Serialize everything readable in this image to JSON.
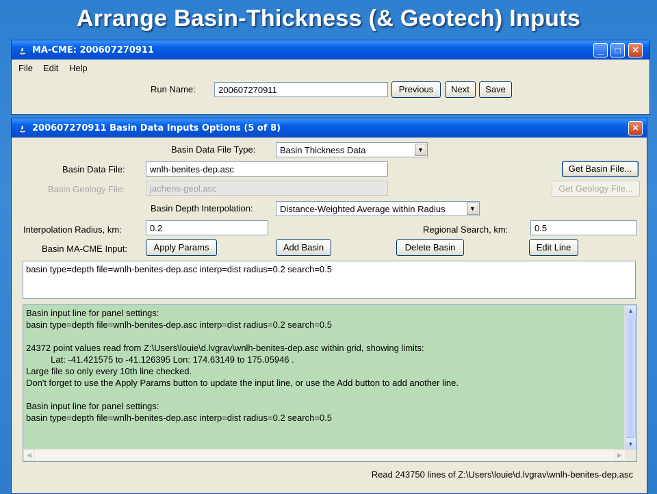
{
  "slide": {
    "title": "Arrange Basin-Thickness (& Geotech) Inputs"
  },
  "main_window": {
    "title": "MA-CME: 200607270911",
    "controls": {
      "minimize": "_",
      "maximize": "□",
      "close": "✕"
    },
    "menu": [
      "File",
      "Edit",
      "Help"
    ],
    "run_name_label": "Run Name:",
    "run_name_value": "200607270911",
    "buttons": {
      "previous": "Previous",
      "next": "Next",
      "save": "Save"
    }
  },
  "dialog": {
    "title": "200607270911 Basin Data Inputs Options  (5 of 8)",
    "close": "✕",
    "file_type_label": "Basin Data File Type:",
    "file_type_value": "Basin Thickness Data",
    "data_file_label": "Basin Data File:",
    "data_file_value": "wnlh-benites-dep.asc",
    "get_basin_file": "Get Basin File...",
    "geology_file_label": "Basin Geology File:",
    "geology_file_value": "jachens-geol.asc",
    "get_geology_file": "Get Geology File...",
    "interp_label": "Basin Depth Interpolation:",
    "interp_value": "Distance-Weighted Average within Radius",
    "radius_label": "Interpolation Radius, km:",
    "radius_value": "0.2",
    "search_label": "Regional Search, km:",
    "search_value": "0.5",
    "input_label": "Basin MA-CME Input:",
    "apply_params": "Apply Params",
    "add_basin": "Add Basin",
    "delete_basin": "Delete Basin",
    "edit_line": "Edit Line",
    "input_line": "basin type=depth file=wnlh-benites-dep.asc interp=dist radius=0.2 search=0.5",
    "log_lines": [
      "Basin input line for panel settings:",
      "basin type=depth file=wnlh-benites-dep.asc interp=dist radius=0.2 search=0.5",
      "",
      "24372 point values read from Z:\\Users\\louie\\d.lvgrav\\wnlh-benites-dep.asc within grid, showing limits:",
      "          Lat: -41.421575 to -41.126395 Lon: 174.63149 to 175.05946 .",
      "Large file so only every 10th line checked.",
      "Don't forget to use the Apply Params button to update the input line, or use the Add button to add another line.",
      "",
      "Basin input line for panel settings:",
      "basin type=depth file=wnlh-benites-dep.asc interp=dist radius=0.2 search=0.5"
    ],
    "status": "Read 243750 lines of Z:\\Users\\louie\\d.lvgrav\\wnlh-benites-dep.asc"
  }
}
